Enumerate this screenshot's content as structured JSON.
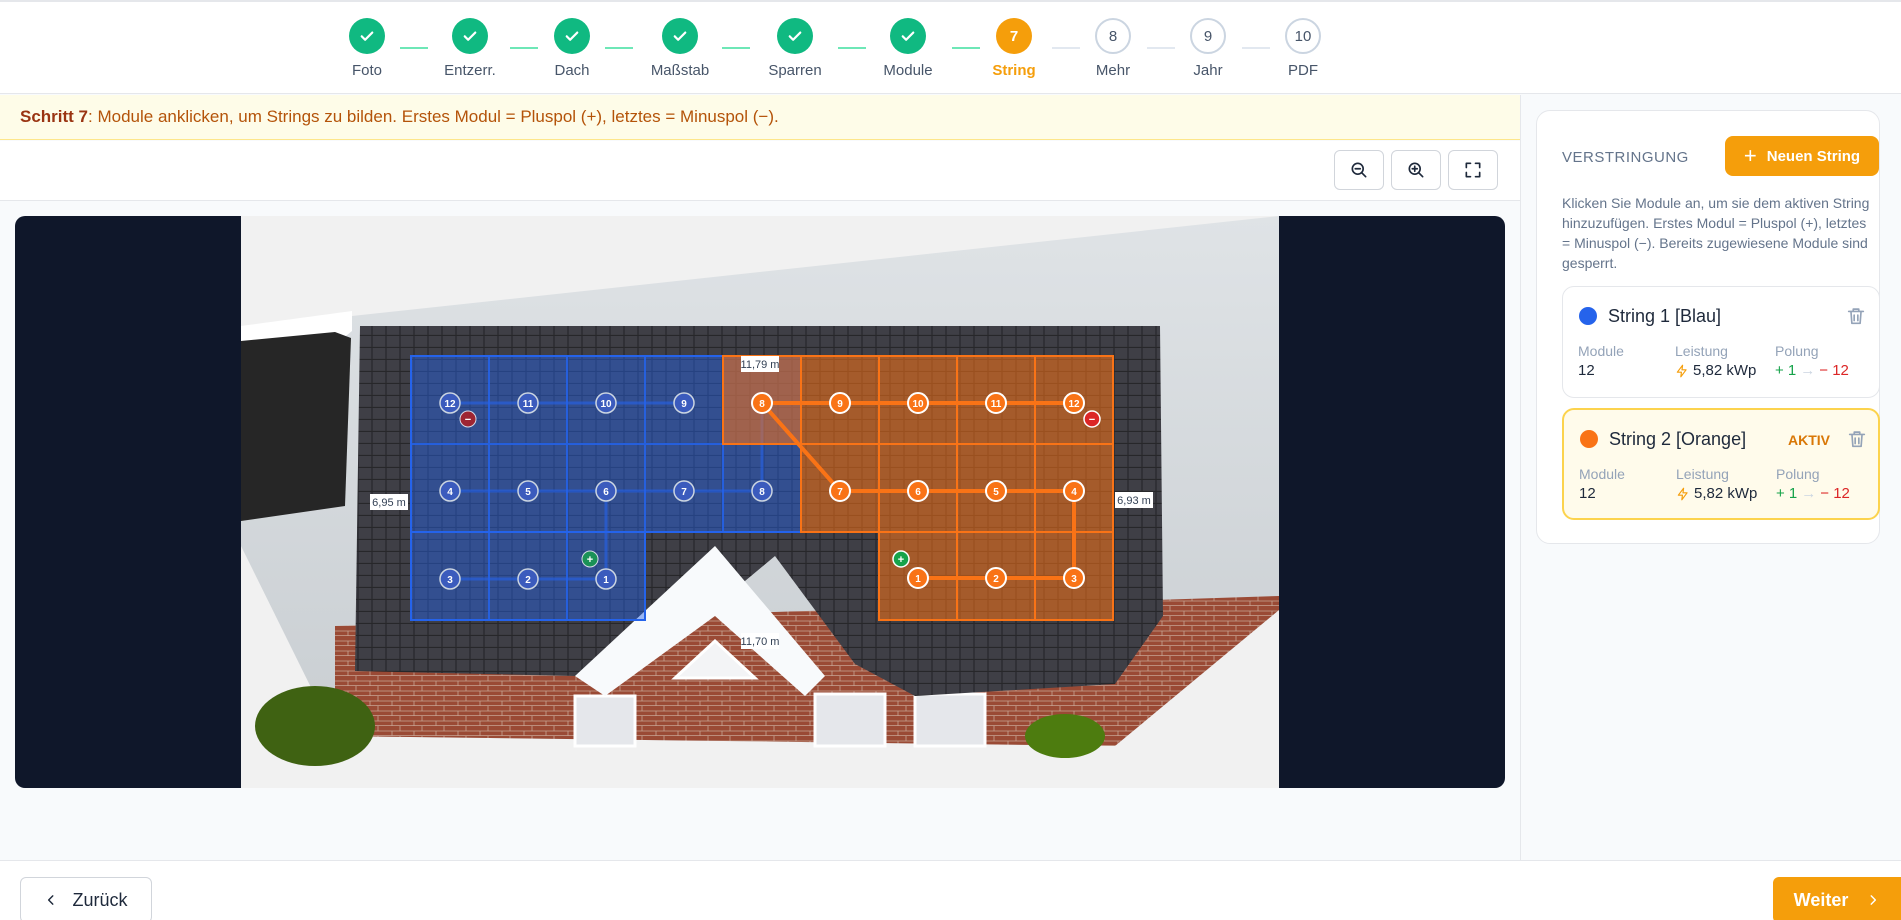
{
  "stepper": {
    "steps": [
      {
        "num": "1",
        "label": "Foto",
        "state": "done"
      },
      {
        "num": "2",
        "label": "Entzerr.",
        "state": "done"
      },
      {
        "num": "3",
        "label": "Dach",
        "state": "done"
      },
      {
        "num": "4",
        "label": "Maßstab",
        "state": "done"
      },
      {
        "num": "5",
        "label": "Sparren",
        "state": "done"
      },
      {
        "num": "6",
        "label": "Module",
        "state": "done"
      },
      {
        "num": "7",
        "label": "String",
        "state": "active"
      },
      {
        "num": "8",
        "label": "Mehr",
        "state": "todo"
      },
      {
        "num": "9",
        "label": "Jahr",
        "state": "todo"
      },
      {
        "num": "10",
        "label": "PDF",
        "state": "todo"
      }
    ],
    "done_icon": "check-icon"
  },
  "hint": {
    "step_label": "Schritt 7",
    "text": ": Module anklicken, um Strings zu bilden. Erstes Modul = Pluspol (+), letztes = Minuspol (−)."
  },
  "toolbar": {
    "icons": [
      "zoom-out-icon",
      "zoom-in-icon",
      "fullscreen-icon"
    ]
  },
  "canvas": {
    "measurements": {
      "top": "11,79 m",
      "bottom": "11,70 m",
      "left": "6,95 m",
      "right": "6,93 m"
    },
    "blue_modules": [
      "12",
      "11",
      "10",
      "9",
      "4",
      "5",
      "6",
      "7",
      "8",
      "3",
      "2",
      "1"
    ],
    "orange_modules": [
      "8",
      "9",
      "10",
      "11",
      "12",
      "7",
      "6",
      "5",
      "4",
      "1",
      "2",
      "3"
    ],
    "plus_marker": "+",
    "minus_marker": "−"
  },
  "panel": {
    "title": "VERSTRINGUNG",
    "new_button": "Neuen String",
    "description": "Klicken Sie Module an, um sie dem aktiven String hinzuzufügen. Erstes Modul = Pluspol (+), letztes = Minuspol (−). Bereits zugewiesene Module sind gesperrt.",
    "strings": [
      {
        "name": "String 1 [Blau]",
        "color": "#2563eb",
        "badge": "",
        "k_modules": "Module",
        "modules": "12",
        "k_power": "Leistung",
        "power": "5,82 kWp",
        "k_polarity": "Polung",
        "pol_plus": "+ 1",
        "pol_arrow": "→",
        "pol_minus": "− 12"
      },
      {
        "name": "String 2 [Orange]",
        "color": "#f97316",
        "badge": "AKTIV",
        "k_modules": "Module",
        "modules": "12",
        "k_power": "Leistung",
        "power": "5,82 kWp",
        "k_polarity": "Polung",
        "pol_plus": "+ 1",
        "pol_arrow": "→",
        "pol_minus": "− 12"
      }
    ]
  },
  "footer": {
    "back_label": "Zurück",
    "next_label": "Weiter"
  },
  "colors": {
    "accent": "#f59e0b",
    "done": "#10b981",
    "blue": "#2563eb",
    "orange": "#f97316"
  }
}
